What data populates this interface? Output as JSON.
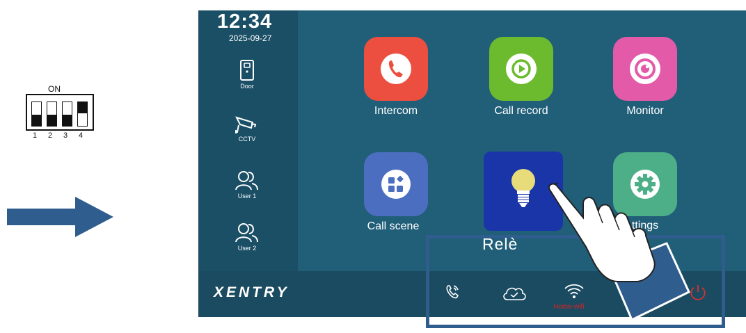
{
  "dip_switch": {
    "label": "ON",
    "switches": [
      {
        "number": "1",
        "state": "off"
      },
      {
        "number": "2",
        "state": "off"
      },
      {
        "number": "3",
        "state": "off"
      },
      {
        "number": "4",
        "state": "on"
      }
    ]
  },
  "arrow": {
    "icon": "right-arrow-icon",
    "color": "#2f5d8e"
  },
  "screen": {
    "time": "12:34",
    "date": "2025-09-27",
    "sidebar": {
      "items": [
        {
          "label": "Door",
          "icon": "door-icon"
        },
        {
          "label": "CCTV",
          "icon": "cctv-icon"
        },
        {
          "label": "User 1",
          "icon": "users-icon"
        },
        {
          "label": "User 2",
          "icon": "users-icon"
        }
      ]
    },
    "apps": [
      {
        "label": "Intercom",
        "icon": "phone-icon",
        "color": "#ec4f3f"
      },
      {
        "label": "Call record",
        "icon": "play-record-icon",
        "color": "#6cbb2e"
      },
      {
        "label": "Monitor",
        "icon": "eye-camera-icon",
        "color": "#e35ba8"
      },
      {
        "label": "Call scene",
        "icon": "grid-scene-icon",
        "color": "#4b6ec0"
      },
      {
        "label": "Relè",
        "icon": "lightbulb-icon",
        "color": "#1a35a8"
      },
      {
        "label": "ttings",
        "icon": "gear-icon",
        "color": "#4caf87"
      }
    ],
    "bottom_bar": {
      "logo": "XENTRY",
      "icons": [
        "phone-call-icon",
        "cloud-check-icon",
        "wifi-icon",
        "power-icon"
      ],
      "wifi_label": "Home-wifi",
      "wifi_label_color": "#e02020"
    }
  }
}
